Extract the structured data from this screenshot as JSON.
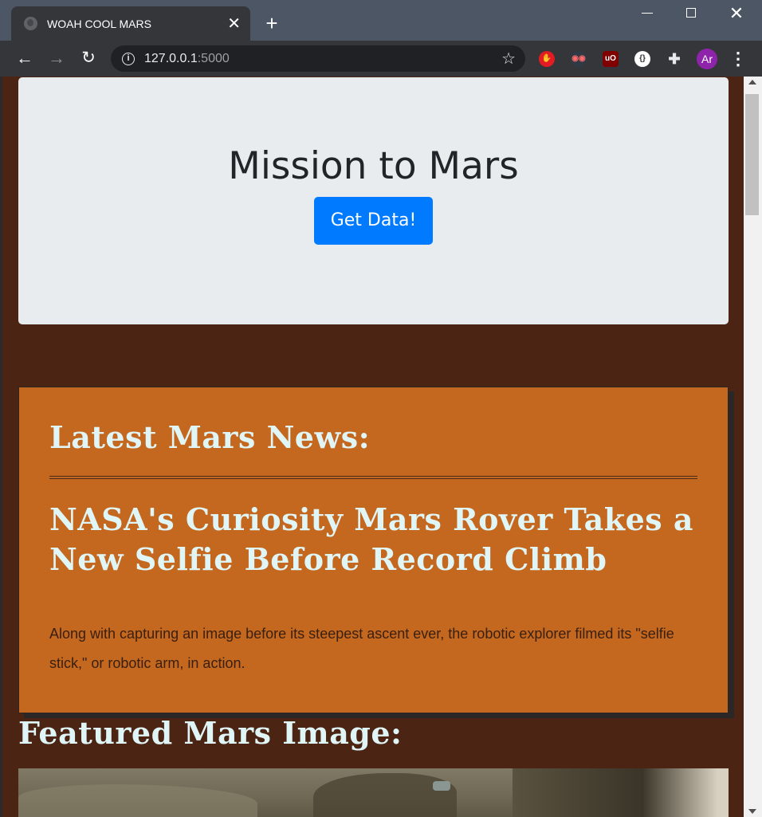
{
  "browser": {
    "tab_title": "WOAH COOL MARS",
    "tab_close": "✕",
    "new_tab": "+",
    "url_host": "127.0.0.1",
    "url_port": ":5000",
    "avatar_initials": "Ar",
    "extensions": [
      "stop-hand",
      "spy-glasses",
      "uO",
      "code-braces",
      "puzzle"
    ]
  },
  "jumbotron": {
    "title": "Mission to Mars",
    "button_label": "Get Data!"
  },
  "news": {
    "header": "Latest Mars News:",
    "title": "NASA's Curiosity Mars Rover Takes a New Selfie Before Record Climb",
    "paragraph": "Along with capturing an image before its steepest ascent ever, the robotic explorer filmed its \"selfie stick,\" or robotic arm, in action."
  },
  "featured": {
    "heading": "Featured Mars Image:"
  },
  "colors": {
    "page_bg": "#4b2414",
    "news_card_bg": "#c4671f",
    "heading_text": "#e0f5f5",
    "button_primary": "#007bff",
    "jumbotron_bg": "#e9ecef"
  }
}
